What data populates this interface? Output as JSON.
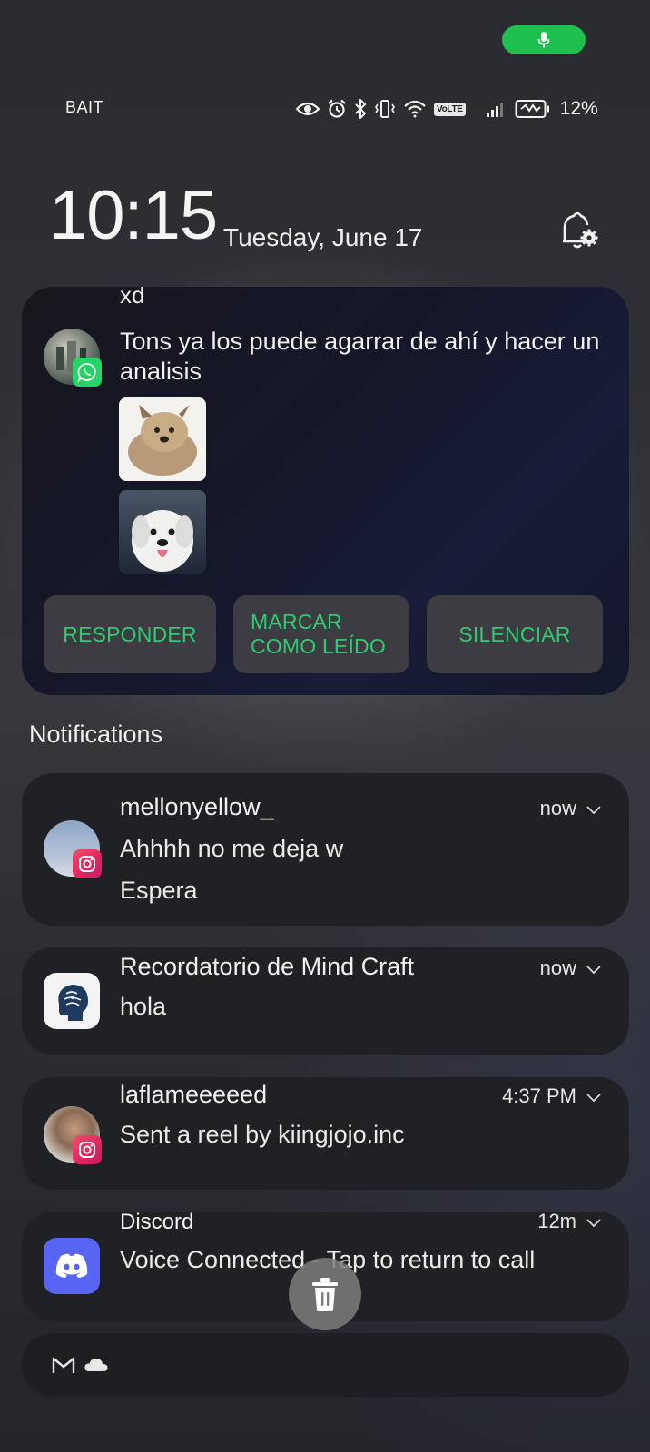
{
  "status_bar": {
    "carrier": "BAIT",
    "volte_label": "VoLTE",
    "battery_percent": "12%",
    "icons": [
      "eye-icon",
      "alarm-icon",
      "bluetooth-icon",
      "vibrate-icon",
      "wifi-icon",
      "volte-icon",
      "signal-icon",
      "battery-saver-icon"
    ],
    "mic_pill_color": "#1fbf4f"
  },
  "lockscreen": {
    "time": "10:15",
    "date": "Tuesday, June 17"
  },
  "whatsapp_card": {
    "previous_line": "xd",
    "message": "Tons ya los puede agarrar de ahí y hacer un analisis",
    "app_icon": "whatsapp-icon",
    "actions": {
      "reply": "RESPONDER",
      "mark_read_line1": "MARCAR",
      "mark_read_line2": "COMO LEÍDO",
      "mute": "SILENCIAR"
    },
    "action_color": "#2ecc71"
  },
  "notifications_header": "Notifications",
  "notifications": [
    {
      "title": "mellonyellow_",
      "line1": "Ahhhh no me deja w",
      "line2": "Espera",
      "time": "now",
      "app": "instagram-icon"
    },
    {
      "title": "Recordatorio de Mind Craft",
      "line1": "hola",
      "time": "now",
      "app": "mind-craft-icon"
    },
    {
      "title": "laflameeeeed",
      "line1": "Sent a reel by kiingjojo.inc",
      "time": "4:37 PM",
      "app": "instagram-icon"
    },
    {
      "title": "Discord",
      "line1": "Voice Connected - Tap to return to call",
      "time": "12m",
      "app": "discord-icon"
    }
  ],
  "collapsed_row_icons": [
    "gmail-icon",
    "cloud-icon"
  ],
  "dismiss_button_icon": "trash-icon"
}
